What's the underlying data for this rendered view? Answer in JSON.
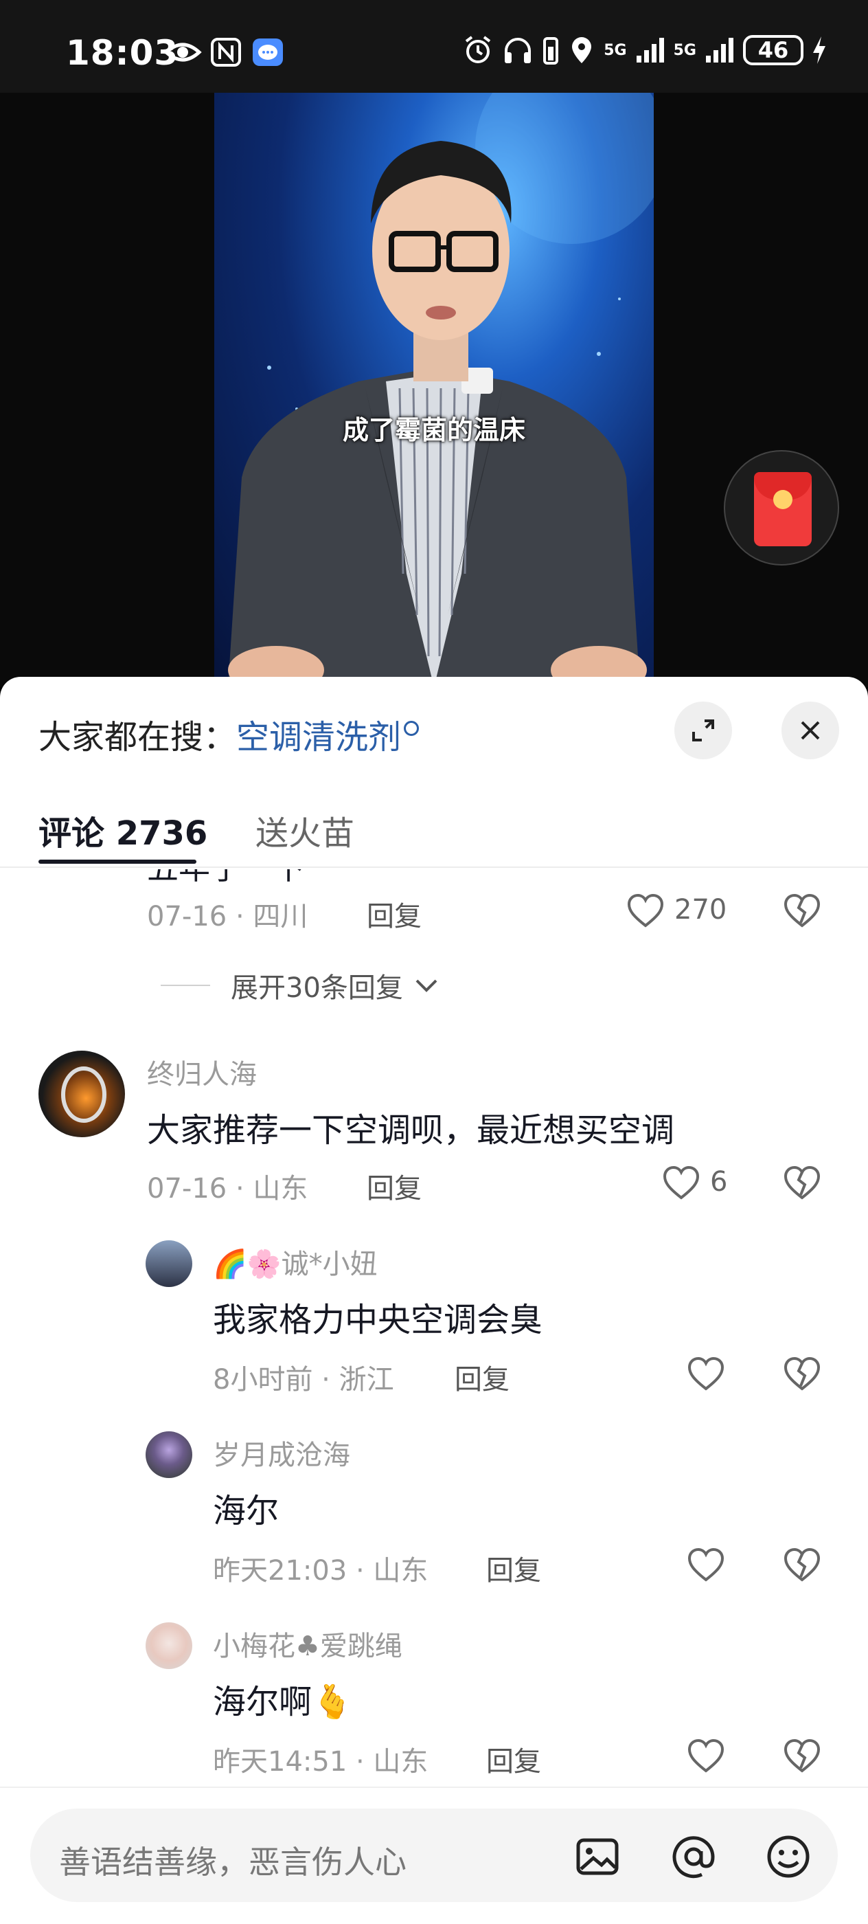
{
  "status_bar": {
    "time": "18:03",
    "network_1": "5G",
    "network_2": "5G",
    "battery": "46"
  },
  "video": {
    "subtitle": "成了霉菌的温床"
  },
  "sheet": {
    "hot_search_prefix": "大家都在搜：",
    "hot_search_keyword": "空调清洗剂",
    "tabs": [
      {
        "label": "评论 2736"
      },
      {
        "label": "送火苗"
      }
    ]
  },
  "comments": {
    "partial": {
      "text_fragment": "五年了一下",
      "date_loc": "07-16 · 四川",
      "reply": "回复",
      "likes": "270"
    },
    "expand_label": "展开30条回复",
    "main": {
      "username": "终归人海",
      "text": "大家推荐一下空调呗，最近想买空调",
      "date_loc": "07-16 · 山东",
      "reply": "回复",
      "likes": "6"
    },
    "replies": [
      {
        "username": "诚*小妞",
        "text": "我家格力中央空调会臭",
        "date_loc": "8小时前 · 浙江",
        "reply": "回复"
      },
      {
        "username": "岁月成沧海",
        "text": "海尔",
        "date_loc": "昨天21:03 · 山东",
        "reply": "回复"
      },
      {
        "username_1": "小梅花",
        "username_2": "爱跳绳",
        "text": "海尔啊",
        "date_loc": "昨天14:51 · 山东",
        "reply": "回复"
      }
    ]
  },
  "input": {
    "placeholder": "善语结善缘，恶言伤人心"
  }
}
